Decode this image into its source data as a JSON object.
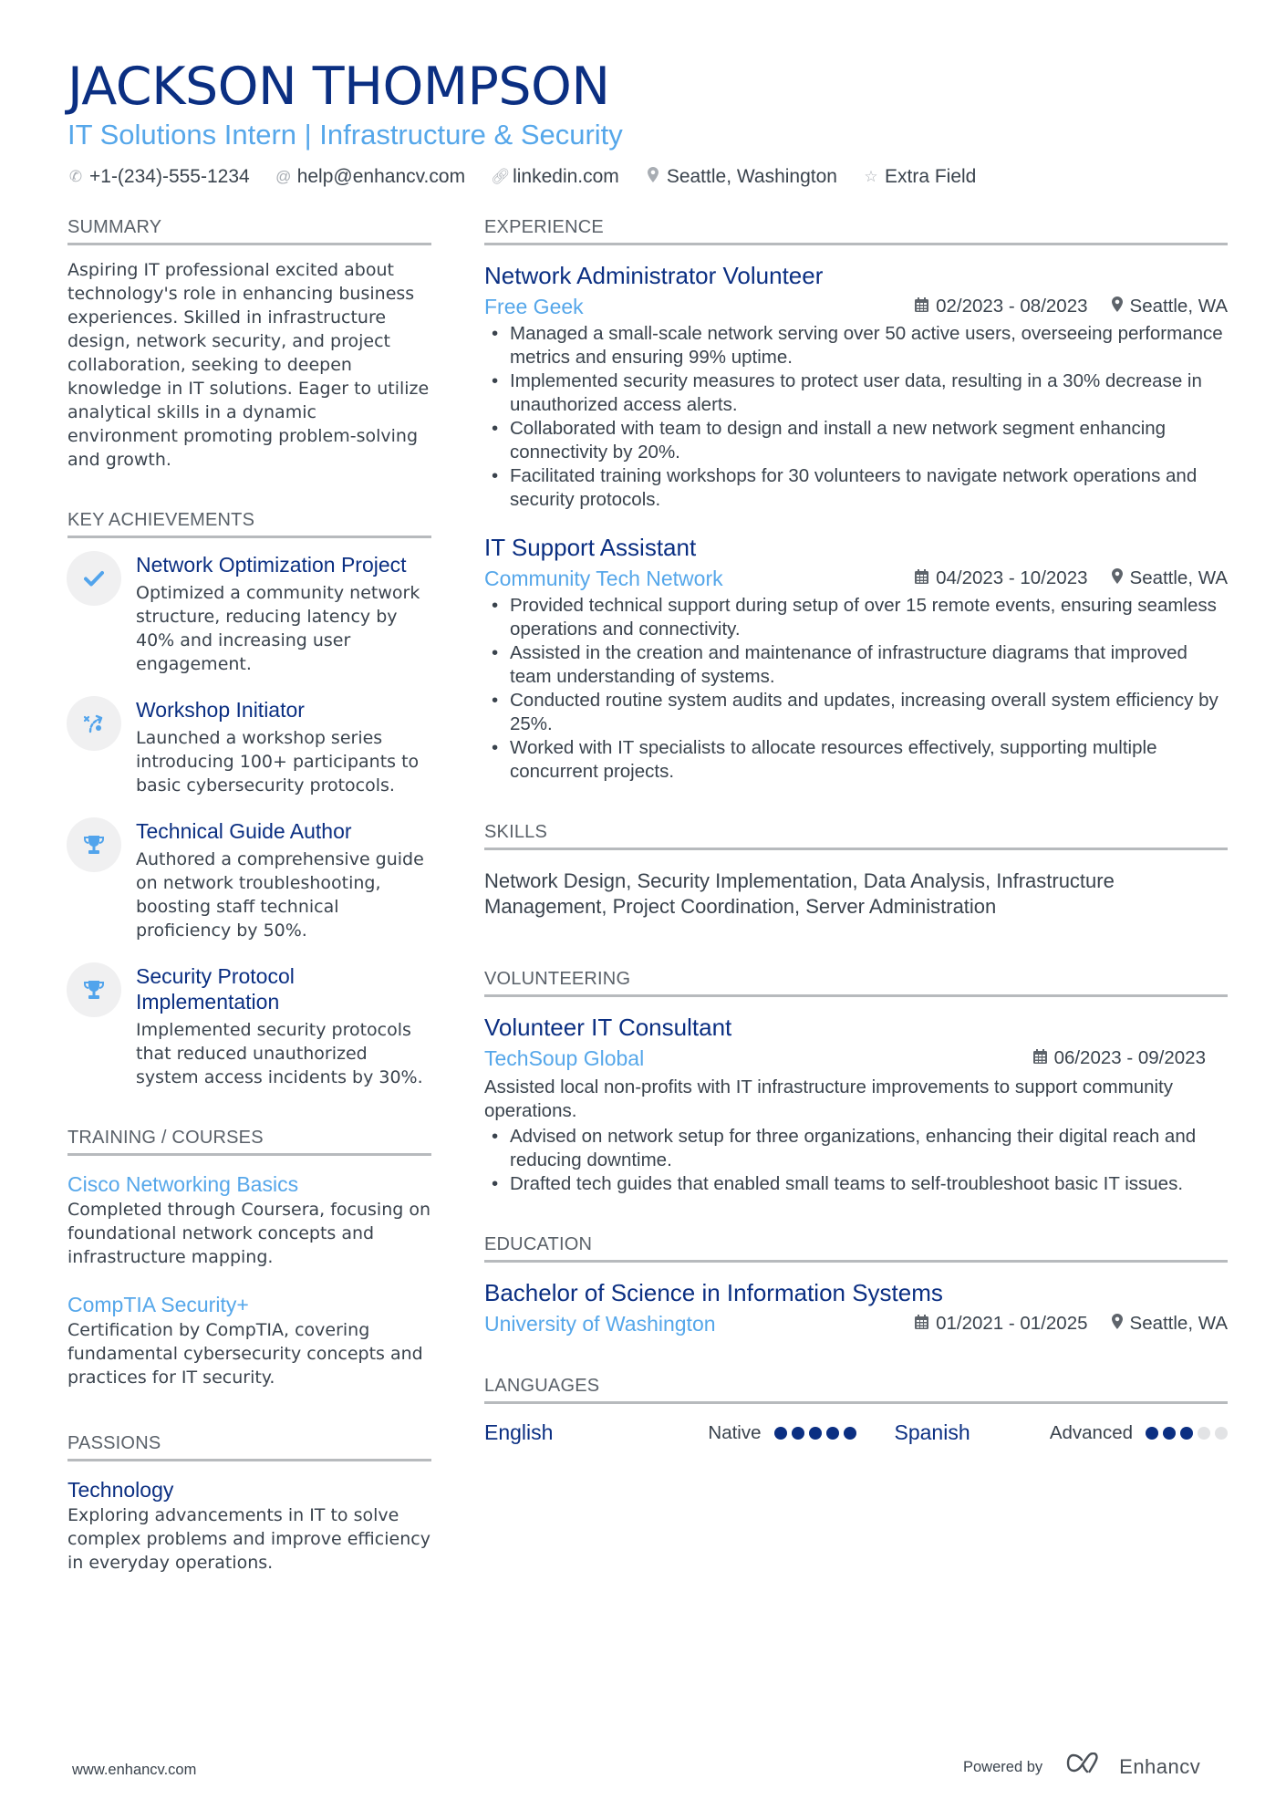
{
  "header": {
    "name": "JACKSON THOMPSON",
    "subtitle": "IT Solutions Intern | Infrastructure & Security",
    "contacts": [
      {
        "icon": "phone-icon",
        "text": "+1-(234)-555-1234"
      },
      {
        "icon": "at-icon",
        "text": "help@enhancv.com"
      },
      {
        "icon": "link-icon",
        "text": "linkedin.com"
      },
      {
        "icon": "location-icon",
        "text": "Seattle, Washington"
      },
      {
        "icon": "star-icon",
        "text": "Extra Field"
      }
    ]
  },
  "colors": {
    "primary": "#0b2f82",
    "accent": "#56a7ea",
    "text": "#3a434d",
    "rule": "#b7babd",
    "icon_bg": "#f0f0f1"
  },
  "summary": {
    "title": "SUMMARY",
    "text": "Aspiring IT professional excited about technology's role in enhancing business experiences. Skilled in infrastructure design, network security, and project collaboration, seeking to deepen knowledge in IT solutions. Eager to utilize analytical skills in a dynamic environment promoting problem-solving and growth."
  },
  "achievements": {
    "title": "KEY ACHIEVEMENTS",
    "items": [
      {
        "icon": "checkmark-icon",
        "title": "Network Optimization Project",
        "desc": "Optimized a community network structure, reducing latency by 40% and increasing user engagement."
      },
      {
        "icon": "route-icon",
        "title": "Workshop Initiator",
        "desc": "Launched a workshop series introducing 100+ participants to basic cybersecurity protocols."
      },
      {
        "icon": "trophy-icon",
        "title": "Technical Guide Author",
        "desc": "Authored a comprehensive guide on network troubleshooting, boosting staff technical proficiency by 50%."
      },
      {
        "icon": "trophy-icon",
        "title": "Security Protocol Implementation",
        "desc": "Implemented security protocols that reduced unauthorized system access incidents by 30%."
      }
    ]
  },
  "training": {
    "title": "TRAINING / COURSES",
    "items": [
      {
        "title": "Cisco Networking Basics",
        "desc": "Completed through Coursera, focusing on foundational network concepts and infrastructure mapping."
      },
      {
        "title": "CompTIA Security+",
        "desc": "Certification by CompTIA, covering fundamental cybersecurity concepts and practices for IT security."
      }
    ]
  },
  "passions": {
    "title": "PASSIONS",
    "items": [
      {
        "title": "Technology",
        "desc": "Exploring advancements in IT to solve complex problems and improve efficiency in everyday operations."
      }
    ]
  },
  "experience": {
    "title": "EXPERIENCE",
    "items": [
      {
        "title": "Network Administrator Volunteer",
        "company": "Free Geek",
        "dates": "02/2023 - 08/2023",
        "location": "Seattle, WA",
        "bullets": [
          "Managed a small-scale network serving over 50 active users, overseeing performance metrics and ensuring 99% uptime.",
          "Implemented security measures to protect user data, resulting in a 30% decrease in unauthorized access alerts.",
          "Collaborated with team to design and install a new network segment enhancing connectivity by 20%.",
          "Facilitated training workshops for 30 volunteers to navigate network operations and security protocols."
        ]
      },
      {
        "title": "IT Support Assistant",
        "company": "Community Tech Network",
        "dates": "04/2023 - 10/2023",
        "location": "Seattle, WA",
        "bullets": [
          "Provided technical support during setup of over 15 remote events, ensuring seamless operations and connectivity.",
          "Assisted in the creation and maintenance of infrastructure diagrams that improved team understanding of systems.",
          "Conducted routine system audits and updates, increasing overall system efficiency by 25%.",
          "Worked with IT specialists to allocate resources effectively, supporting multiple concurrent projects."
        ]
      }
    ]
  },
  "skills": {
    "title": "SKILLS",
    "text": "Network Design, Security Implementation, Data Analysis, Infrastructure Management, Project Coordination, Server Administration"
  },
  "volunteering": {
    "title": "VOLUNTEERING",
    "items": [
      {
        "title": "Volunteer IT Consultant",
        "company": "TechSoup Global",
        "dates": "06/2023 - 09/2023",
        "desc": "Assisted local non-profits with IT infrastructure improvements to support community operations.",
        "bullets": [
          "Advised on network setup for three organizations, enhancing their digital reach and reducing downtime.",
          "Drafted tech guides that enabled small teams to self-troubleshoot basic IT issues."
        ]
      }
    ]
  },
  "education": {
    "title": "EDUCATION",
    "items": [
      {
        "degree": "Bachelor of Science in Information Systems",
        "school": "University of Washington",
        "dates": "01/2021 - 01/2025",
        "location": "Seattle, WA"
      }
    ]
  },
  "languages": {
    "title": "LANGUAGES",
    "items": [
      {
        "name": "English",
        "level": "Native",
        "rating": 5,
        "max": 5
      },
      {
        "name": "Spanish",
        "level": "Advanced",
        "rating": 3,
        "max": 5
      }
    ]
  },
  "footer": {
    "website": "www.enhancv.com",
    "powered_by": "Powered by",
    "brand": "Enhancv"
  }
}
